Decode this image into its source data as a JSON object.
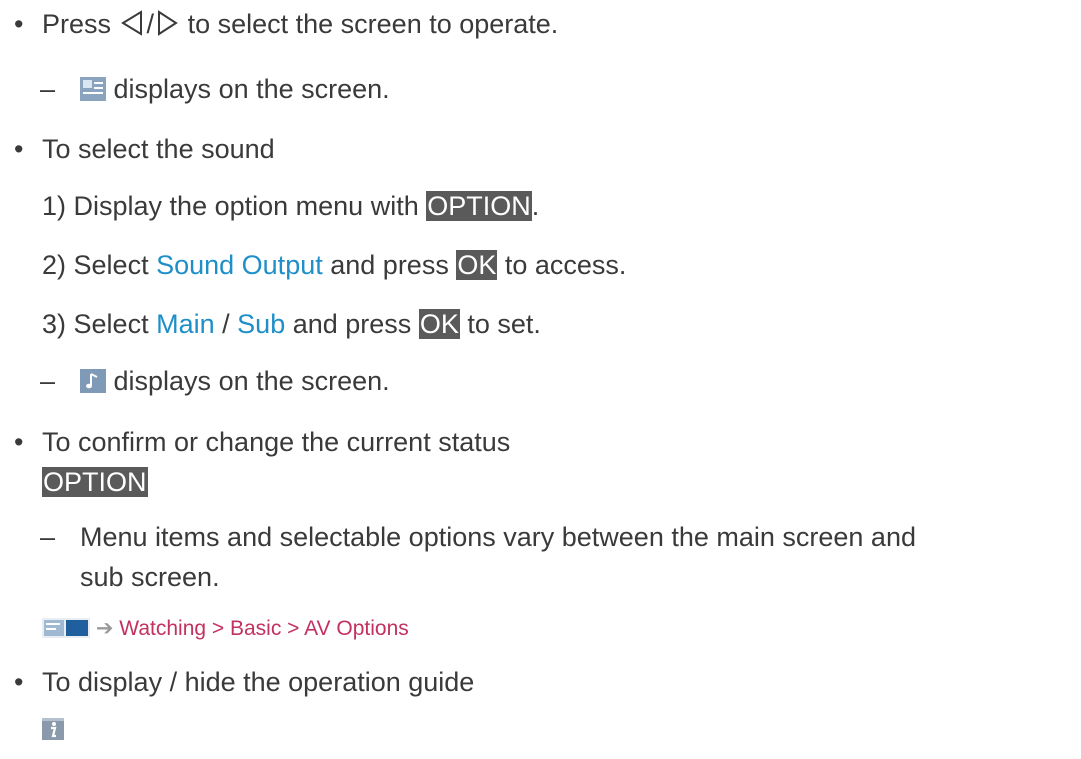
{
  "bullet_char": "•",
  "dash_char": "–",
  "item1": {
    "press": "Press",
    "slash": "/",
    "rest": "to select the screen to operate.",
    "sub": "displays on the screen.",
    "icons": [
      "triangle-left-icon",
      "triangle-right-icon",
      "screen-select-icon"
    ]
  },
  "item2": {
    "heading": "To select the sound",
    "step1": {
      "num": "1)",
      "pre": "Display the option menu with",
      "key": "OPTION",
      "post": "."
    },
    "step2": {
      "num": "2)",
      "pre": "Select",
      "link": "Sound Output",
      "mid": "and press",
      "key": "OK",
      "post": "to access."
    },
    "step3": {
      "num": "3)",
      "pre": "Select",
      "link1": "Main",
      "sep": "/",
      "link2": "Sub",
      "mid": "and press",
      "key": "OK",
      "post": "to set."
    },
    "sub": "displays on the screen.",
    "icon": "music-note-icon"
  },
  "item3": {
    "heading": "To confirm or change the current status",
    "key": "OPTION",
    "note_line1": "Menu items and selectable options vary between the main screen and",
    "note_line2": "sub screen.",
    "breadcrumb": "Watching > Basic > AV Options",
    "icon": "manual-book-icon"
  },
  "item4": {
    "heading": "To display / hide the operation guide",
    "icon": "info-icon"
  },
  "colors": {
    "link": "#1e8fc8",
    "breadcrumb": "#c2315f",
    "key_bg": "#5a5a5a",
    "text": "#3a3a3a"
  }
}
